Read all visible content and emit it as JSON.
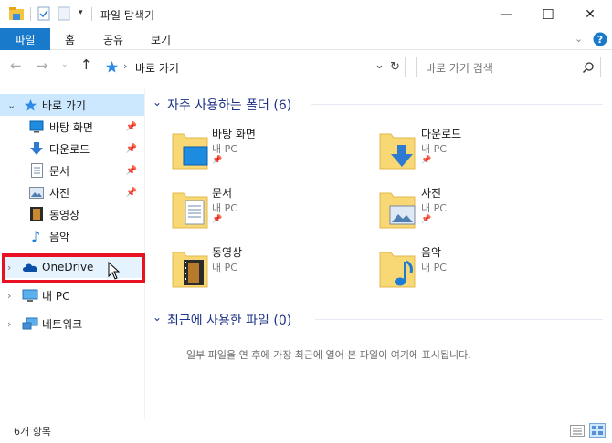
{
  "window": {
    "title": "파일 탐색기",
    "minimize": "—",
    "maximize": "☐",
    "close": "✕"
  },
  "ribbon": {
    "file_tab": "파일",
    "tabs": [
      "홈",
      "공유",
      "보기"
    ]
  },
  "address": {
    "path": "바로 가기",
    "search_placeholder": "바로 가기 검색"
  },
  "nav": {
    "quick_access": "바로 가기",
    "items": [
      {
        "label": "바탕 화면",
        "pinned": true
      },
      {
        "label": "다운로드",
        "pinned": true
      },
      {
        "label": "문서",
        "pinned": true
      },
      {
        "label": "사진",
        "pinned": true
      },
      {
        "label": "동영상",
        "pinned": false
      },
      {
        "label": "음악",
        "pinned": false
      }
    ],
    "onedrive": "OneDrive",
    "this_pc": "내 PC",
    "network": "네트워크"
  },
  "content": {
    "frequent_header": "자주 사용하는 폴더 (6)",
    "folders": [
      {
        "name": "바탕 화면",
        "location": "내 PC",
        "pinned": true
      },
      {
        "name": "다운로드",
        "location": "내 PC",
        "pinned": true
      },
      {
        "name": "문서",
        "location": "내 PC",
        "pinned": true
      },
      {
        "name": "사진",
        "location": "내 PC",
        "pinned": true
      },
      {
        "name": "동영상",
        "location": "내 PC",
        "pinned": false
      },
      {
        "name": "음악",
        "location": "내 PC",
        "pinned": false
      }
    ],
    "recent_header": "최근에 사용한 파일 (0)",
    "recent_empty": "일부 파일을 연 후에 가장 최근에 열어 본 파일이 여기에 표시됩니다."
  },
  "status": {
    "count": "6개 항목"
  },
  "colors": {
    "accent": "#1979ca",
    "selection": "#cce8ff",
    "highlight_box": "#e81123",
    "folder": "#f8d775"
  }
}
